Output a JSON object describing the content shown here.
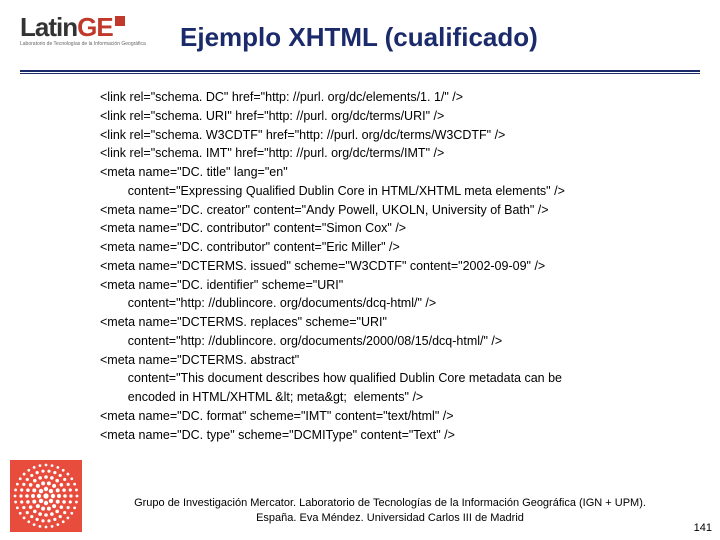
{
  "logo": {
    "brand_a": "Latin",
    "brand_b": "GE",
    "sub": "Laboratorio de Tecnologías de la Información Geográfica"
  },
  "title": "Ejemplo XHTML (cualificado)",
  "code_lines": [
    "<link rel=\"schema. DC\" href=\"http: //purl. org/dc/elements/1. 1/\" />",
    "<link rel=\"schema. URI\" href=\"http: //purl. org/dc/terms/URI\" />",
    "<link rel=\"schema. W3CDTF\" href=\"http: //purl. org/dc/terms/W3CDTF\" />",
    "<link rel=\"schema. IMT\" href=\"http: //purl. org/dc/terms/IMT\" />",
    "<meta name=\"DC. title\" lang=\"en\"",
    "        content=\"Expressing Qualified Dublin Core in HTML/XHTML meta elements\" />",
    "<meta name=\"DC. creator\" content=\"Andy Powell, UKOLN, University of Bath\" />",
    "<meta name=\"DC. contributor\" content=\"Simon Cox\" />",
    "<meta name=\"DC. contributor\" content=\"Eric Miller\" />",
    "<meta name=\"DCTERMS. issued\" scheme=\"W3CDTF\" content=\"2002-09-09\" />",
    "<meta name=\"DC. identifier\" scheme=\"URI\"",
    "        content=\"http: //dublincore. org/documents/dcq-html/\" />",
    "<meta name=\"DCTERMS. replaces\" scheme=\"URI\"",
    "        content=\"http: //dublincore. org/documents/2000/08/15/dcq-html/\" />",
    "<meta name=\"DCTERMS. abstract\"",
    "        content=\"This document describes how qualified Dublin Core metadata can be",
    "        encoded in HTML/XHTML &lt; meta&gt;  elements\" />",
    "<meta name=\"DC. format\" scheme=\"IMT\" content=\"text/html\" />",
    "<meta name=\"DC. type\" scheme=\"DCMIType\" content=\"Text\" />"
  ],
  "footer": {
    "line1": "Grupo de Investigación Mercator. Laboratorio de Tecnologías de la Información Geográfica (IGN + UPM).",
    "line2": "España.  Eva Méndez. Universidad Carlos III de Madrid"
  },
  "page_number": "141",
  "colors": {
    "title": "#1b2a6b",
    "accent": "#c0392b",
    "dots_outer": "#e74c3c",
    "dots_inner": "#ffffff"
  }
}
